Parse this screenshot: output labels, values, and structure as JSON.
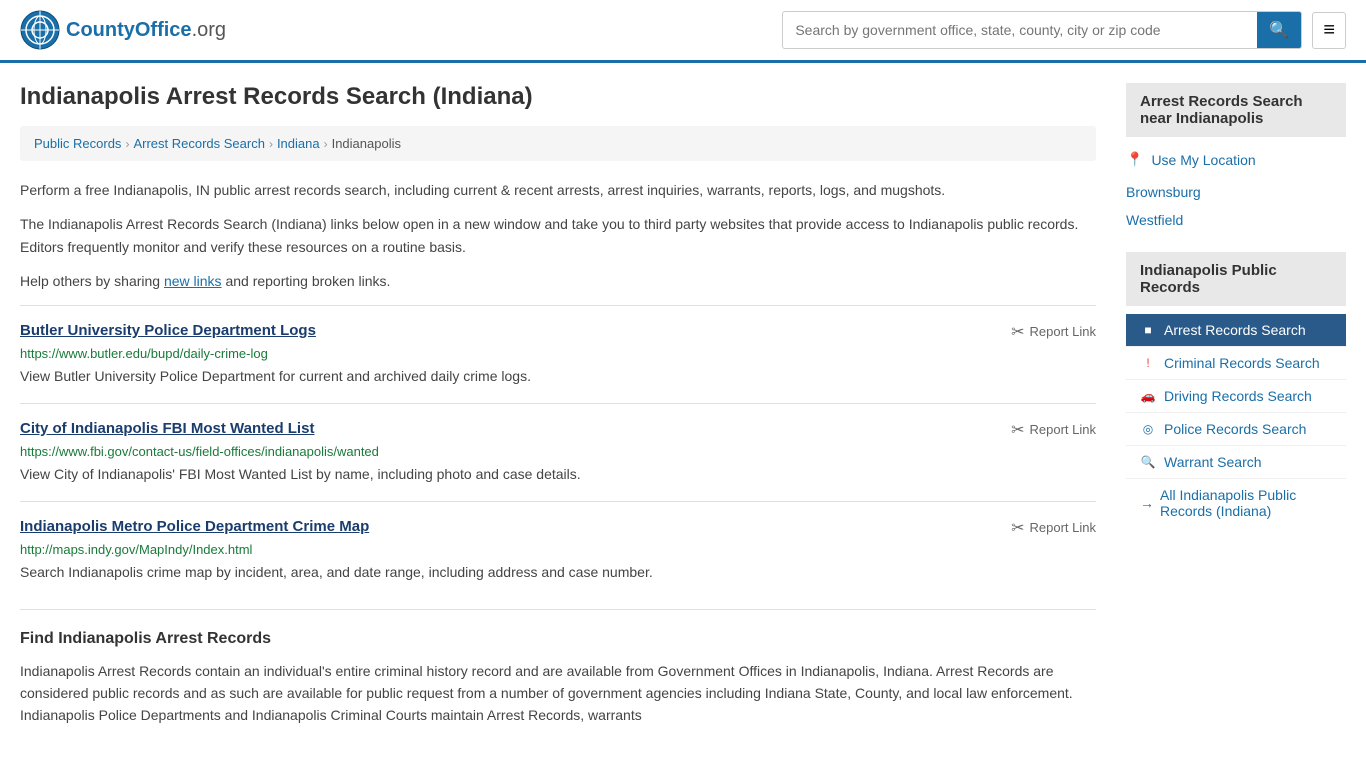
{
  "header": {
    "logo_text": "CountyOffice",
    "logo_suffix": ".org",
    "search_placeholder": "Search by government office, state, county, city or zip code",
    "search_button_icon": "🔍"
  },
  "page": {
    "title": "Indianapolis Arrest Records Search (Indiana)"
  },
  "breadcrumb": {
    "items": [
      "Public Records",
      "Arrest Records Search",
      "Indiana",
      "Indianapolis"
    ]
  },
  "description": {
    "para1": "Perform a free Indianapolis, IN public arrest records search, including current & recent arrests, arrest inquiries, warrants, reports, logs, and mugshots.",
    "para2": "The Indianapolis Arrest Records Search (Indiana) links below open in a new window and take you to third party websites that provide access to Indianapolis public records. Editors frequently monitor and verify these resources on a routine basis.",
    "para3_prefix": "Help others by sharing ",
    "para3_link": "new links",
    "para3_suffix": " and reporting broken links."
  },
  "records": [
    {
      "title": "Butler University Police Department Logs",
      "url": "https://www.butler.edu/bupd/daily-crime-log",
      "description": "View Butler University Police Department for current and archived daily crime logs.",
      "report_label": "Report Link"
    },
    {
      "title": "City of Indianapolis FBI Most Wanted List",
      "url": "https://www.fbi.gov/contact-us/field-offices/indianapolis/wanted",
      "description": "View City of Indianapolis' FBI Most Wanted List by name, including photo and case details.",
      "report_label": "Report Link"
    },
    {
      "title": "Indianapolis Metro Police Department Crime Map",
      "url": "http://maps.indy.gov/MapIndy/Index.html",
      "description": "Search Indianapolis crime map by incident, area, and date range, including address and case number.",
      "report_label": "Report Link"
    }
  ],
  "find_section": {
    "title": "Find Indianapolis Arrest Records",
    "text": "Indianapolis Arrest Records contain an individual's entire criminal history record and are available from Government Offices in Indianapolis, Indiana. Arrest Records are considered public records and as such are available for public request from a number of government agencies including Indiana State, County, and local law enforcement. Indianapolis Police Departments and Indianapolis Criminal Courts maintain Arrest Records, warrants"
  },
  "sidebar": {
    "nearby_header": "Arrest Records Search near Indianapolis",
    "use_my_location": "Use My Location",
    "nearby_links": [
      "Brownsburg",
      "Westfield"
    ],
    "public_records_header": "Indianapolis Public Records",
    "nav_items": [
      {
        "label": "Arrest Records Search",
        "icon": "■",
        "active": true
      },
      {
        "label": "Criminal Records Search",
        "icon": "!",
        "active": false
      },
      {
        "label": "Driving Records Search",
        "icon": "🚗",
        "active": false
      },
      {
        "label": "Police Records Search",
        "icon": "◎",
        "active": false
      },
      {
        "label": "Warrant Search",
        "icon": "🔍",
        "active": false
      }
    ],
    "all_records_label": "All Indianapolis Public Records (Indiana)",
    "all_records_arrow": "→"
  }
}
